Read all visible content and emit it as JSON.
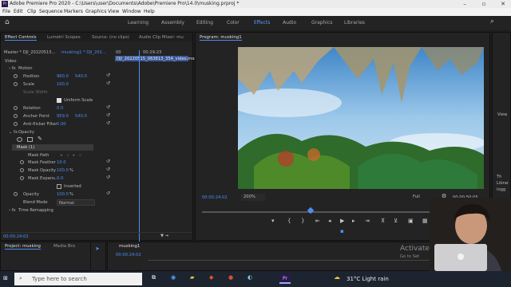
{
  "window": {
    "title": "Adobe Premiere Pro 2020 - C:\\Users\\user\\Documents\\Adobe\\Premiere Pro\\14.0\\musking.prproj *",
    "logo_text": "Pr"
  },
  "menu": [
    "File",
    "Edit",
    "Clip",
    "Sequence",
    "Markers",
    "Graphics",
    "View",
    "Window",
    "Help"
  ],
  "workspaces": {
    "items": [
      "Learning",
      "Assembly",
      "Editing",
      "Color",
      "Effects",
      "Audio",
      "Graphics",
      "Libraries"
    ],
    "active": "Effects"
  },
  "left_tabs": [
    "Effect Controls",
    "Lumetri Scopes",
    "Source: (no clips)",
    "Audio Clip Mixer: mu"
  ],
  "effect_controls": {
    "master_label": "Master * DJI_20220515...",
    "sequence_label": "musking1 * DJI_202...",
    "clip_bar": "DJI_20220515_063813_354_video.mo",
    "mini_timecode_start": "00",
    "mini_timecode_mid": "00:29:23",
    "section_video": "Video",
    "fx_motion": "Motion",
    "position_label": "Position",
    "position_x": "960.0",
    "position_y": "540.0",
    "scale_label": "Scale",
    "scale_value": "100.0",
    "scale_width_label": "Scale Width",
    "uniform_scale_label": "Uniform Scale",
    "rotation_label": "Rotation",
    "rotation_value": "0.0",
    "anchor_label": "Anchor Point",
    "anchor_x": "959.0",
    "anchor_y": "540.0",
    "antiflicker_label": "Anti-flicker Filter",
    "antiflicker_value": "0.00",
    "fx_opacity": "Opacity",
    "mask_label": "Mask (1)",
    "mask_path_label": "Mask Path",
    "mask_feather_label": "Mask Feather",
    "mask_feather_value": "10.0",
    "mask_opacity_label": "Mask Opacity",
    "mask_opacity_value": "100.0",
    "mask_opacity_unit": "%",
    "mask_expansion_label": "Mask Expans...",
    "mask_expansion_value": "0.0",
    "inverted_label": "Inverted",
    "opacity_label": "Opacity",
    "opacity_value": "100.0",
    "opacity_unit": "%",
    "blend_mode_label": "Blend Mode",
    "blend_mode_value": "Normal",
    "time_remapping_label": "Time Remapping",
    "footer_timecode": "00:00:24:02"
  },
  "program": {
    "tab_label": "Program: musking1",
    "timecode": "00:00:24:02",
    "zoom": "200%",
    "quality": "Full",
    "duration": "00:00:50:05"
  },
  "right_panel": {
    "view_label": "View",
    "side_lines": [
      "Th",
      "Librar",
      "logg"
    ]
  },
  "bottom": {
    "project_tab": "Project: musking",
    "media_browser_tab": "Media Bro",
    "sequence_tab": "musking1",
    "seq_timecode": "00:00:24:02"
  },
  "activate": {
    "line1": "Activate",
    "line2": "Go to Set"
  },
  "taskbar": {
    "search_placeholder": "Type here to search",
    "weather": "31°C  Light rain",
    "app_badge": "Pr"
  },
  "colors": {
    "accent_blue": "#4a8ff5",
    "panel_bg": "#232323",
    "title_bar": "#ececec"
  }
}
